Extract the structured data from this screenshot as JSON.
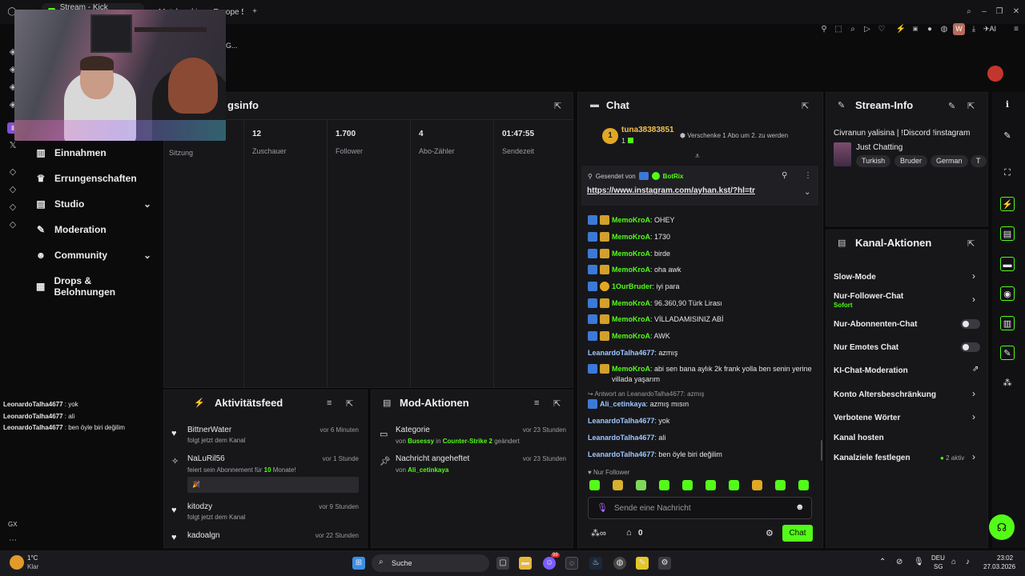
{
  "browser": {
    "tabs": [
      {
        "label": "Stream - Kick Dashboard",
        "active": true,
        "favicon_color": "#53fc18"
      },
      {
        "label": "Matchmaking - Europe 5v5",
        "active": false,
        "favicon_color": "#f2a33a"
      }
    ],
    "address_fragment": "G...",
    "toolbar_icons": [
      "pin-icon",
      "screenshot-icon",
      "search-page-icon",
      "play-icon",
      "heart-icon",
      "extension-icon",
      "nhd-icon",
      "record-icon",
      "camera-icon",
      "puzzle-icon",
      "download-icon",
      "aria-icon"
    ],
    "toolbar_ai_label": "AI",
    "avatar_badge": "W"
  },
  "nav": {
    "items": [
      {
        "label": "Einnahmen",
        "icon": "bank-icon"
      },
      {
        "label": "Errungenschaften",
        "icon": "trophy-icon"
      },
      {
        "label": "Studio",
        "icon": "studio-icon",
        "has_chevron": true
      },
      {
        "label": "Moderation",
        "icon": "wrench-icon"
      },
      {
        "label": "Community",
        "icon": "community-icon",
        "has_chevron": true
      },
      {
        "label": "Drops & Belohnungen",
        "icon": "gift-icon"
      }
    ],
    "bottom_label": "GX"
  },
  "stream_overlay_chat": [
    {
      "user": "LeonardoTalha4677",
      "text": "yok"
    },
    {
      "user": "LeonardoTalha4677",
      "text": "ali"
    },
    {
      "user": "LeonardoTalha4677",
      "text": "ben öyle biri değilim"
    }
  ],
  "session_panel": {
    "title_fragment": "gsinfo",
    "first_col_label": "Sitzung",
    "stats": [
      {
        "value": "12",
        "label": "Zuschauer"
      },
      {
        "value": "1.700",
        "label": "Follower"
      },
      {
        "value": "4",
        "label": "Abo-Zähler"
      },
      {
        "value": "01:47:55",
        "label": "Sendezeit"
      }
    ]
  },
  "activity_feed": {
    "title": "Aktivitätsfeed",
    "items": [
      {
        "name": "BittnerWater",
        "desc": "folgt jetzt dem Kanal",
        "time": "vor 6 Minuten",
        "icon": "heart-icon"
      },
      {
        "name": "NaLuRil56",
        "desc_prefix": "feiert sein Abonnement für ",
        "desc_highlight": "10",
        "desc_suffix": " Monate!",
        "time": "vor 1 Stunde",
        "icon": "confetti-icon",
        "note": "🎉"
      },
      {
        "name": "kitodzy",
        "desc": "folgt jetzt dem Kanal",
        "time": "vor 9 Stunden",
        "icon": "heart-icon"
      },
      {
        "name": "kadoalgn",
        "desc": "",
        "time": "vor 22 Stunden",
        "icon": "heart-icon"
      }
    ]
  },
  "mod_actions": {
    "title": "Mod-Aktionen",
    "items": [
      {
        "title": "Kategorie",
        "by": "von",
        "user": "Busessy",
        "in": "in",
        "target": "Counter-Strike 2",
        "suffix": "geändert",
        "time": "vor 23 Stunden",
        "icon": "category-icon"
      },
      {
        "title": "Nachricht angeheftet",
        "by": "von",
        "user": "Ali_cetinkaya",
        "time": "vor 23 Stunden",
        "icon": "pin-icon"
      }
    ]
  },
  "chat": {
    "title": "Chat",
    "gift_user": "tuna38383851",
    "gift_count": "1",
    "gift_text": "Verschenke 1 Abo um 2. zu werden",
    "pinned": {
      "label": "Gesendet von",
      "user": "BotRix",
      "link": "https://www.instagram.com/ayhan.kst/?hl=tr"
    },
    "messages": [
      {
        "user": "MemoKroA",
        "text": "OHEY",
        "badges": [
          "blue",
          "gold"
        ],
        "ucls": "u-green"
      },
      {
        "user": "MemoKroA",
        "text": "1730",
        "badges": [
          "blue",
          "gold"
        ],
        "ucls": "u-green"
      },
      {
        "user": "MemoKroA",
        "text": "birde",
        "badges": [
          "blue",
          "gold"
        ],
        "ucls": "u-green"
      },
      {
        "user": "MemoKroA",
        "text": "oha awk",
        "badges": [
          "blue",
          "gold"
        ],
        "ucls": "u-green"
      },
      {
        "user": "1OurBruder",
        "text": "iyi para",
        "badges": [
          "blue",
          "coin"
        ],
        "ucls": "u-green"
      },
      {
        "user": "MemoKroA",
        "text": "96.360,90 Türk Lirası",
        "badges": [
          "blue",
          "gold"
        ],
        "ucls": "u-green"
      },
      {
        "user": "MemoKroA",
        "text": "VİLLADAMISINIZ ABİ",
        "badges": [
          "blue",
          "gold"
        ],
        "ucls": "u-green"
      },
      {
        "user": "MemoKroA",
        "text": "AWK",
        "badges": [
          "blue",
          "gold"
        ],
        "ucls": "u-green"
      },
      {
        "user": "LeanardoTalha4677",
        "text": "azmış",
        "badges": [],
        "ucls": "u-lblue"
      },
      {
        "user": "MemoKroA",
        "text": "abi sen bana aylık 2k frank yolla ben senin yerine villada yaşarım",
        "badges": [
          "blue",
          "gold"
        ],
        "ucls": "u-green"
      }
    ],
    "reply_context": "Antwort an LeanardoTalha4677: azmış",
    "reply": {
      "user": "Ali_cetinkaya",
      "text": "azmış mısın"
    },
    "messages2": [
      {
        "user": "LeanardoTalha4677",
        "text": "yok"
      },
      {
        "user": "LeanardoTalha4677",
        "text": "ali"
      },
      {
        "user": "LeanardoTalha4677",
        "text": "ben öyle biri değilim"
      }
    ],
    "mode_label": "Nur Follower",
    "emotes": 10,
    "input_placeholder": "Sende eine Nachricht",
    "points_value": "0",
    "send_label": "Chat"
  },
  "stream_info": {
    "title": "Stream-Info",
    "stream_title": "Civranun yalisina | !Discord !instagram",
    "category": "Just Chatting",
    "tags": [
      "Turkish",
      "Bruder",
      "German",
      "T"
    ]
  },
  "channel_actions": {
    "title": "Kanal-Aktionen",
    "items": [
      {
        "label": "Slow-Mode",
        "control": "chevron"
      },
      {
        "label": "Nur-Follower-Chat",
        "sub": "Sofort",
        "control": "chevron"
      },
      {
        "label": "Nur-Abonnenten-Chat",
        "control": "toggle"
      },
      {
        "label": "Nur Emotes Chat",
        "control": "toggle"
      },
      {
        "label": "KI-Chat-Moderation",
        "control": "external"
      },
      {
        "label": "Konto Altersbeschränkung",
        "control": "chevron"
      },
      {
        "label": "Verbotene Wörter",
        "control": "chevron"
      },
      {
        "label": "Kanal hosten",
        "control": "none"
      },
      {
        "label": "Kanalziele festlegen",
        "control": "chevron",
        "status": "2 aktiv"
      }
    ]
  },
  "taskbar": {
    "weather_temp": "1°C",
    "weather_desc": "Klar",
    "search_label": "Suche",
    "lang_top": "DEU",
    "lang_bottom": "SG",
    "time": "23:02",
    "date": "27.03.2026",
    "notif_count": "99"
  },
  "colors": {
    "accent": "#53fc18",
    "panel": "#17171a",
    "background": "#0b0b0c"
  }
}
